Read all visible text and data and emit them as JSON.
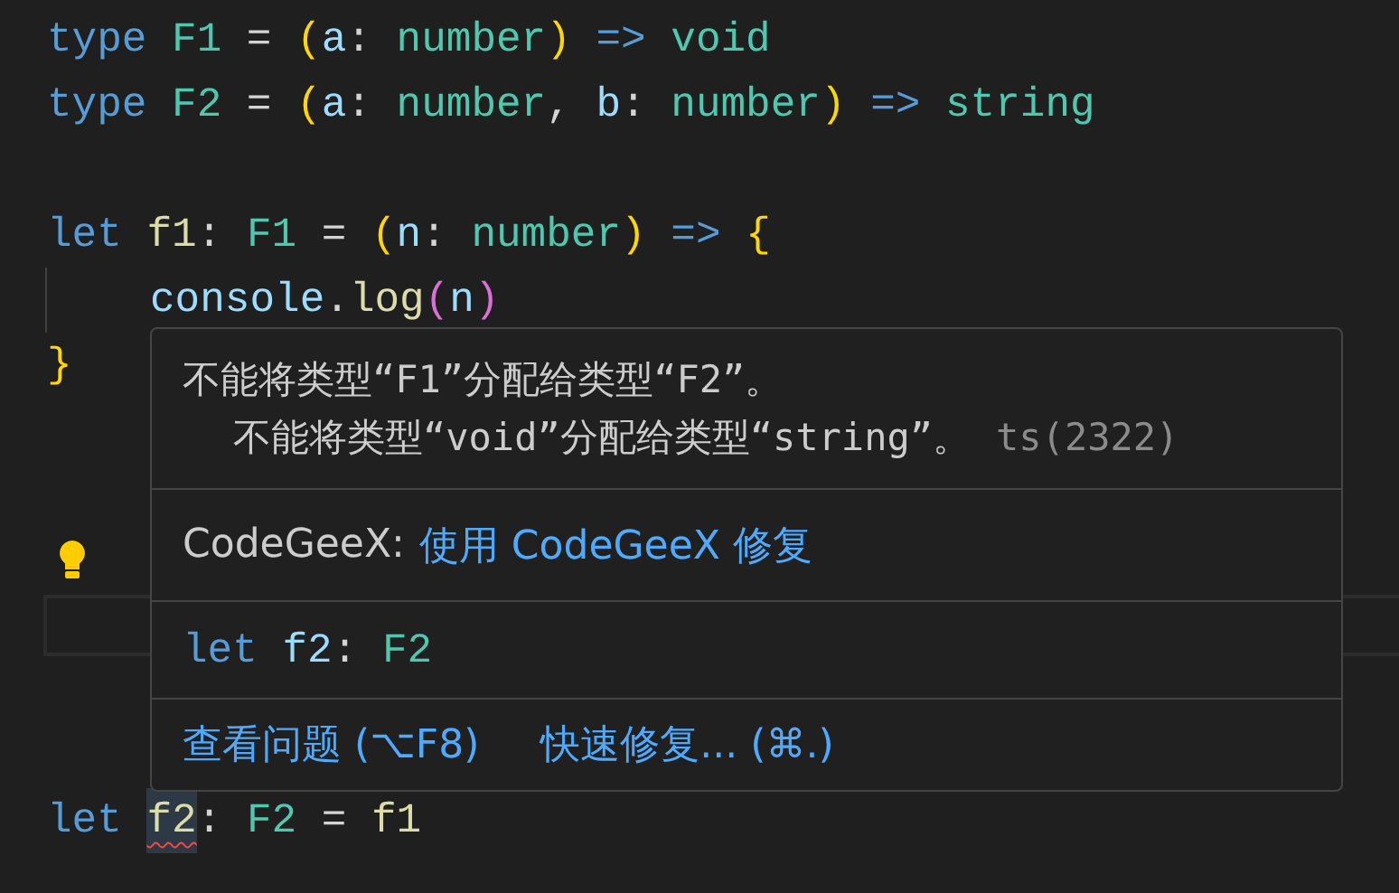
{
  "code": {
    "lines": [
      {
        "kind": "code",
        "tokens": [
          {
            "text": "type ",
            "kind": "keyword"
          },
          {
            "text": "F1",
            "kind": "type"
          },
          {
            "text": " = ",
            "kind": "punct"
          },
          {
            "text": "(",
            "kind": "paren"
          },
          {
            "text": "a",
            "kind": "param"
          },
          {
            "text": ": ",
            "kind": "punct"
          },
          {
            "text": "number",
            "kind": "type"
          },
          {
            "text": ") ",
            "kind": "paren"
          },
          {
            "text": "=> ",
            "kind": "keyword"
          },
          {
            "text": "void",
            "kind": "type"
          }
        ]
      },
      {
        "kind": "code",
        "tokens": [
          {
            "text": "type ",
            "kind": "keyword"
          },
          {
            "text": "F2",
            "kind": "type"
          },
          {
            "text": " = ",
            "kind": "punct"
          },
          {
            "text": "(",
            "kind": "paren"
          },
          {
            "text": "a",
            "kind": "param"
          },
          {
            "text": ": ",
            "kind": "punct"
          },
          {
            "text": "number",
            "kind": "type"
          },
          {
            "text": ", ",
            "kind": "punct"
          },
          {
            "text": "b",
            "kind": "param"
          },
          {
            "text": ": ",
            "kind": "punct"
          },
          {
            "text": "number",
            "kind": "type"
          },
          {
            "text": ") ",
            "kind": "paren"
          },
          {
            "text": "=> ",
            "kind": "keyword"
          },
          {
            "text": "string",
            "kind": "type"
          }
        ]
      },
      {
        "kind": "blank"
      },
      {
        "kind": "code",
        "tokens": [
          {
            "text": "let ",
            "kind": "keyword"
          },
          {
            "text": "f1",
            "kind": "func"
          },
          {
            "text": ": ",
            "kind": "punct"
          },
          {
            "text": "F1",
            "kind": "type"
          },
          {
            "text": " = ",
            "kind": "punct"
          },
          {
            "text": "(",
            "kind": "paren"
          },
          {
            "text": "n",
            "kind": "param"
          },
          {
            "text": ": ",
            "kind": "punct"
          },
          {
            "text": "number",
            "kind": "type"
          },
          {
            "text": ") ",
            "kind": "paren"
          },
          {
            "text": "=> ",
            "kind": "keyword"
          },
          {
            "text": "{",
            "kind": "paren"
          }
        ]
      },
      {
        "kind": "code",
        "indent_guide": true,
        "tokens": [
          {
            "text": "console",
            "kind": "param"
          },
          {
            "text": ".",
            "kind": "punct"
          },
          {
            "text": "log",
            "kind": "func"
          },
          {
            "text": "(",
            "kind": "paren2"
          },
          {
            "text": "n",
            "kind": "param"
          },
          {
            "text": ")",
            "kind": "paren2"
          }
        ]
      },
      {
        "kind": "code",
        "tokens": [
          {
            "text": "}",
            "kind": "paren"
          }
        ]
      },
      {
        "kind": "blank"
      },
      {
        "kind": "blank"
      },
      {
        "kind": "lightbulb"
      },
      {
        "kind": "current"
      },
      {
        "kind": "blank"
      },
      {
        "kind": "blank"
      },
      {
        "kind": "code",
        "tokens": [
          {
            "text": "let ",
            "kind": "keyword"
          },
          {
            "text": "f2",
            "kind": "func",
            "error": true,
            "highlighted": true
          },
          {
            "text": ": ",
            "kind": "punct"
          },
          {
            "text": "F2",
            "kind": "type"
          },
          {
            "text": " = ",
            "kind": "punct"
          },
          {
            "text": "f1",
            "kind": "func"
          }
        ]
      }
    ]
  },
  "hover": {
    "messages": [
      {
        "text": "不能将类型“F1”分配给类型“F2”。"
      },
      {
        "text": "不能将类型“void”分配给类型“string”。",
        "code": "ts(2322)"
      }
    ],
    "codegeex": {
      "label": "CodeGeeX:",
      "link": "使用 CodeGeeX 修复"
    },
    "peek": [
      {
        "text": "let ",
        "kind": "keyword"
      },
      {
        "text": "f2",
        "kind": "param"
      },
      {
        "text": ": ",
        "kind": "punct"
      },
      {
        "text": "F2",
        "kind": "type"
      }
    ],
    "actions": [
      "查看问题 (⌥F8)",
      "快速修复... (⌘.)"
    ]
  }
}
